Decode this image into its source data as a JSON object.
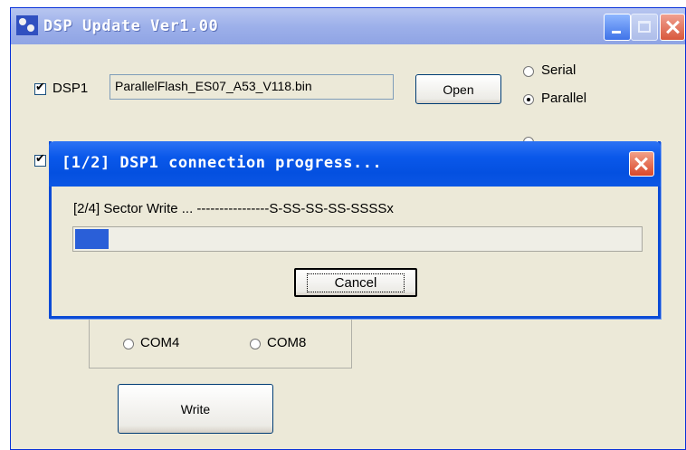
{
  "main_window": {
    "title": "DSP Update Ver1.00",
    "dsp1": {
      "label": "DSP1",
      "file": "ParallelFlash_ES07_A53_V118.bin",
      "open_label": "Open",
      "serial_label": "Serial",
      "parallel_label": "Parallel"
    },
    "com_group": {
      "com4_label": "COM4",
      "com8_label": "COM8"
    },
    "write_label": "Write"
  },
  "dialog": {
    "title": "[1/2] DSP1 connection progress...",
    "status": "[2/4] Sector Write ... ----------------S-SS-SS-SS-SSSSx",
    "progress_fraction": 0.06,
    "cancel_label": "Cancel",
    "colors": {
      "title_bar": "#0450e0",
      "progress_fill": "#2a5fd8"
    }
  }
}
